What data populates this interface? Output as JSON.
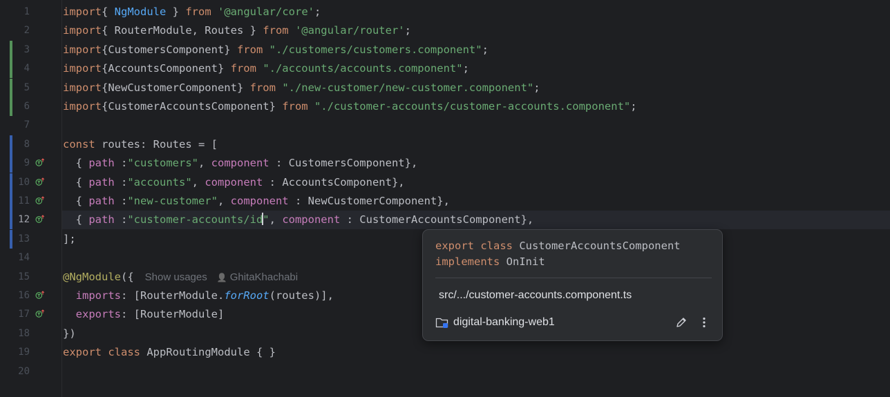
{
  "editor": {
    "current_line": 12,
    "line_numbers": [
      "1",
      "2",
      "3",
      "4",
      "5",
      "6",
      "7",
      "8",
      "9",
      "10",
      "11",
      "12",
      "13",
      "14",
      "15",
      "16",
      "17",
      "18",
      "19",
      "20"
    ],
    "lines": [
      [
        [
          "k",
          "import"
        ],
        [
          "",
          "{ "
        ],
        [
          "t",
          "NgModule"
        ],
        [
          "",
          " } "
        ],
        [
          "k",
          "from"
        ],
        [
          "",
          " "
        ],
        [
          "s",
          "'@angular/core'"
        ],
        [
          "",
          ";"
        ]
      ],
      [
        [
          "k",
          "import"
        ],
        [
          "",
          "{ RouterModule, Routes } "
        ],
        [
          "k",
          "from"
        ],
        [
          "",
          " "
        ],
        [
          "s",
          "'@angular/router'"
        ],
        [
          "",
          ";"
        ]
      ],
      [
        [
          "k",
          "import"
        ],
        [
          "",
          "{CustomersComponent} "
        ],
        [
          "k",
          "from"
        ],
        [
          "",
          " "
        ],
        [
          "s",
          "\"./customers/customers.component\""
        ],
        [
          "",
          ";"
        ]
      ],
      [
        [
          "k",
          "import"
        ],
        [
          "",
          "{AccountsComponent} "
        ],
        [
          "k",
          "from"
        ],
        [
          "",
          " "
        ],
        [
          "s",
          "\"./accounts/accounts.component\""
        ],
        [
          "",
          ";"
        ]
      ],
      [
        [
          "k",
          "import"
        ],
        [
          "",
          "{NewCustomerComponent} "
        ],
        [
          "k",
          "from"
        ],
        [
          "",
          " "
        ],
        [
          "s",
          "\"./new-customer/new-customer.component\""
        ],
        [
          "",
          ";"
        ]
      ],
      [
        [
          "k",
          "import"
        ],
        [
          "",
          "{CustomerAccountsComponent} "
        ],
        [
          "k",
          "from"
        ],
        [
          "",
          " "
        ],
        [
          "s",
          "\"./customer-accounts/customer-accounts.component\""
        ],
        [
          "",
          ";"
        ]
      ],
      [],
      [
        [
          "k",
          "const"
        ],
        [
          "",
          " routes: Routes = ["
        ]
      ],
      [
        [
          "",
          "  { "
        ],
        [
          "p",
          "path"
        ],
        [
          "",
          " :"
        ],
        [
          "s",
          "\"customers\""
        ],
        [
          "",
          ", "
        ],
        [
          "p",
          "component"
        ],
        [
          "",
          " : CustomersComponent},"
        ]
      ],
      [
        [
          "",
          "  { "
        ],
        [
          "p",
          "path"
        ],
        [
          "",
          " :"
        ],
        [
          "s",
          "\"accounts\""
        ],
        [
          "",
          ", "
        ],
        [
          "p",
          "component"
        ],
        [
          "",
          " : AccountsComponent},"
        ]
      ],
      [
        [
          "",
          "  { "
        ],
        [
          "p",
          "path"
        ],
        [
          "",
          " :"
        ],
        [
          "s",
          "\"new-customer\""
        ],
        [
          "",
          ", "
        ],
        [
          "p",
          "component"
        ],
        [
          "",
          " : NewCustomerComponent},"
        ]
      ],
      [
        [
          "",
          "  { "
        ],
        [
          "p",
          "path"
        ],
        [
          "",
          " :"
        ],
        [
          "s",
          "\"customer-accounts/id"
        ],
        [
          "caret",
          ""
        ],
        [
          "s",
          "\""
        ],
        [
          "",
          ", "
        ],
        [
          "p",
          "component"
        ],
        [
          "",
          " : CustomerAccountsComponent},"
        ]
      ],
      [
        [
          "",
          "];"
        ]
      ],
      [],
      [
        [
          "an",
          "@NgModule"
        ],
        [
          "",
          "({"
        ]
      ],
      [
        [
          "",
          "  "
        ],
        [
          "p",
          "imports"
        ],
        [
          "",
          ": [RouterModule."
        ],
        [
          "fi",
          "forRoot"
        ],
        [
          "",
          "(routes)],"
        ]
      ],
      [
        [
          "",
          "  "
        ],
        [
          "p",
          "exports"
        ],
        [
          "",
          ": [RouterModule]"
        ]
      ],
      [
        [
          "",
          "})"
        ]
      ],
      [
        [
          "k",
          "export"
        ],
        [
          "",
          " "
        ],
        [
          "k",
          "class"
        ],
        [
          "",
          " AppRoutingModule { }"
        ]
      ],
      []
    ],
    "inlay_hint": {
      "line": 15,
      "usages": "Show usages",
      "author": "GhitaKhachabi"
    },
    "vcs_added_lines": [
      3,
      4,
      5,
      6
    ],
    "vcs_modified_lines": [
      8,
      9,
      10,
      11,
      12,
      13
    ],
    "implement_icon_lines": [
      9,
      10,
      11,
      12,
      16,
      17
    ]
  },
  "popup": {
    "signature_line1": [
      [
        "k",
        "export class"
      ],
      [
        "",
        " CustomerAccountsComponent"
      ]
    ],
    "signature_line2": [
      [
        "k",
        "implements"
      ],
      [
        "",
        " OnInit"
      ]
    ],
    "path": "src/.../customer-accounts.component.ts",
    "project": "digital-banking-web1",
    "folder_icon": "project-folder-icon",
    "edit_icon": "pencil-icon",
    "more_icon": "more-vertical-icon"
  }
}
